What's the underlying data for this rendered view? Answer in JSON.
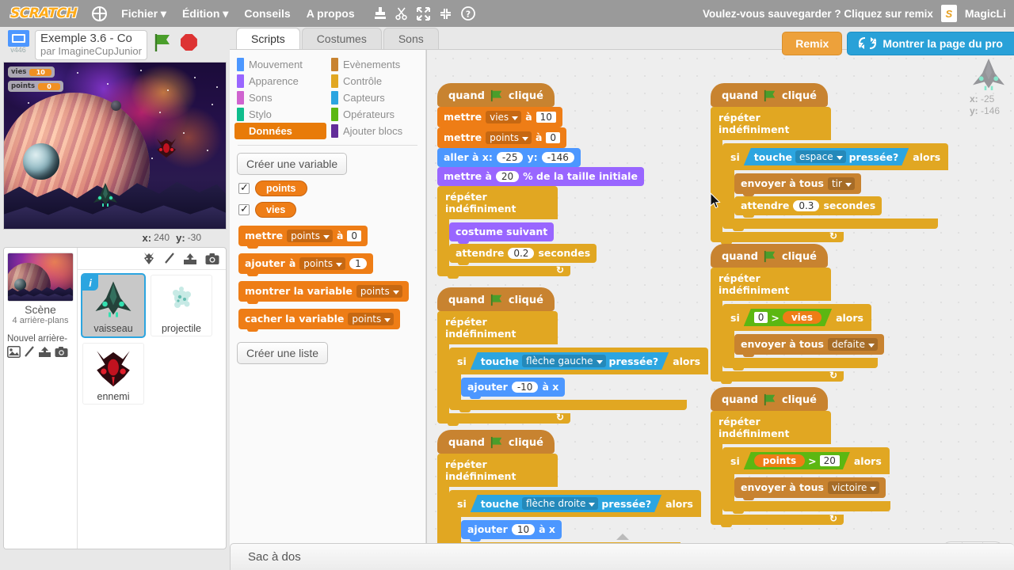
{
  "menubar": {
    "logo": "SCRATCH",
    "globe_icon": "globe-icon",
    "items": [
      "Fichier",
      "Édition",
      "Conseils",
      "A propos"
    ],
    "tools": [
      "stamp-icon",
      "scissors-icon",
      "grow-icon",
      "shrink-icon",
      "help-icon"
    ],
    "notice": "Voulez-vous sauvegarder ? Cliquez sur remix",
    "avatar_letter": "S",
    "username": "MagicLi"
  },
  "stage_header": {
    "version_label": "v446",
    "project_title": "Exemple 3.6 - Co",
    "project_author": "par ImagineCupJunior",
    "green_flag_icon": "green-flag-icon",
    "stop_icon": "stop-sign-icon"
  },
  "stage": {
    "monitors": [
      {
        "name": "vies",
        "value": "10"
      },
      {
        "name": "points",
        "value": "0"
      }
    ],
    "coords": {
      "x_label": "x:",
      "x_value": "240",
      "y_label": "y:",
      "y_value": "-30"
    }
  },
  "sprite_pane": {
    "stage_label": "Scène",
    "stage_sub": "4 arrière-plans",
    "new_backdrop_label": "Nouvel arrière-",
    "new_backdrop_icons": [
      "picture-icon",
      "paint-icon",
      "upload-icon",
      "camera-icon"
    ],
    "new_sprite_icons": [
      "surprise-sprite-icon",
      "paint-icon",
      "upload-icon",
      "camera-icon"
    ],
    "sprites": [
      {
        "name": "vaisseau",
        "selected": true,
        "info_badge": "i"
      },
      {
        "name": "projectile",
        "selected": false
      },
      {
        "name": "ennemi",
        "selected": false
      }
    ]
  },
  "editor": {
    "tabs": [
      {
        "label": "Scripts",
        "active": true
      },
      {
        "label": "Costumes",
        "active": false
      },
      {
        "label": "Sons",
        "active": false
      }
    ],
    "remix_button": "Remix",
    "project_page_button": "Montrer la page du pro",
    "project_page_icon": "remix-arrows-icon"
  },
  "palette": {
    "categories": [
      {
        "label": "Mouvement",
        "color": "#4c97ff",
        "active": false
      },
      {
        "label": "Evènements",
        "color": "#c88330",
        "active": false
      },
      {
        "label": "Apparence",
        "color": "#9966ff",
        "active": false
      },
      {
        "label": "Contrôle",
        "color": "#e1a722",
        "active": false
      },
      {
        "label": "Sons",
        "color": "#cf63cf",
        "active": false
      },
      {
        "label": "Capteurs",
        "color": "#2ca5e0",
        "active": false
      },
      {
        "label": "Stylo",
        "color": "#0fbd8c",
        "active": false
      },
      {
        "label": "Opérateurs",
        "color": "#5cb712",
        "active": false
      },
      {
        "label": "Données",
        "color": "#e87b09",
        "active": true
      },
      {
        "label": "Ajouter blocs",
        "color": "#632d99",
        "active": false
      }
    ],
    "create_variable": "Créer une variable",
    "create_list": "Créer une liste",
    "variables": [
      {
        "name": "points",
        "checked": true
      },
      {
        "name": "vies",
        "checked": true
      }
    ],
    "blocks": [
      {
        "words": [
          "mettre"
        ],
        "dropdown": "points",
        "mid": "à",
        "input": "0",
        "input_shape": "square"
      },
      {
        "words": [
          "ajouter",
          "à"
        ],
        "dropdown": "points",
        "input": "1",
        "input_shape": "round"
      },
      {
        "words": [
          "montrer la variable"
        ],
        "dropdown": "points"
      },
      {
        "words": [
          "cacher la variable"
        ],
        "dropdown": "points"
      }
    ]
  },
  "scripts": {
    "watermark": {
      "sprite": "vaisseau",
      "x_label": "x:",
      "x_value": "-25",
      "y_label": "y:",
      "y_value": "-146"
    },
    "zoom_controls": [
      "zoom-out-icon",
      "zoom-reset-icon",
      "zoom-in-icon"
    ],
    "hat_label_pre": "quand",
    "hat_label_post": "cliqué",
    "stacks": [
      {
        "id": "init",
        "blocks": [
          {
            "text1": "mettre",
            "dropdown": "vies",
            "text2": "à",
            "value": "10"
          },
          {
            "text1": "mettre",
            "dropdown": "points",
            "text2": "à",
            "value": "0"
          },
          {
            "text1": "aller à x:",
            "value1": "-25",
            "text2": "y:",
            "value2": "-146"
          },
          {
            "text1": "mettre à",
            "value": "20",
            "text2": "% de la taille initiale"
          }
        ],
        "loop_label": "répéter indéfiniment",
        "loop_body": [
          {
            "text1": "costume suivant"
          },
          {
            "text1": "attendre",
            "value": "0.2",
            "text2": "secondes"
          }
        ]
      },
      {
        "id": "move-left",
        "loop_label": "répéter indéfiniment",
        "if_label": "si",
        "then_label": "alors",
        "condition": {
          "pre": "touche",
          "dropdown": "flèche gauche",
          "post": "pressée?"
        },
        "body": [
          {
            "text1": "ajouter",
            "value": "-10",
            "text2": "à x"
          }
        ]
      },
      {
        "id": "move-right",
        "loop_label": "répéter indéfiniment",
        "if_label": "si",
        "then_label": "alors",
        "condition": {
          "pre": "touche",
          "dropdown": "flèche droite",
          "post": "pressée?"
        },
        "body": [
          {
            "text1": "ajouter",
            "value": "10",
            "text2": "à x"
          }
        ]
      },
      {
        "id": "shoot",
        "loop_label": "répéter indéfiniment",
        "if_label": "si",
        "then_label": "alors",
        "condition": {
          "pre": "touche",
          "dropdown": "espace",
          "post": "pressée?"
        },
        "body": [
          {
            "text1": "envoyer à tous",
            "dropdown": "tir"
          },
          {
            "text1": "attendre",
            "value": "0.3",
            "text2": "secondes"
          }
        ]
      },
      {
        "id": "defeat",
        "loop_label": "répéter indéfiniment",
        "if_label": "si",
        "then_label": "alors",
        "condition_op": {
          "left_value": "0",
          "operator": ">",
          "right_var": "vies"
        },
        "body": [
          {
            "text1": "envoyer à tous",
            "dropdown": "defaite"
          }
        ]
      },
      {
        "id": "victory",
        "loop_label": "répéter indéfiniment",
        "if_label": "si",
        "then_label": "alors",
        "condition_op": {
          "left_var": "points",
          "operator": ">",
          "right_value": "20"
        },
        "body": [
          {
            "text1": "envoyer à tous",
            "dropdown": "victoire"
          }
        ]
      }
    ]
  },
  "backpack": {
    "label": "Sac à dos"
  }
}
